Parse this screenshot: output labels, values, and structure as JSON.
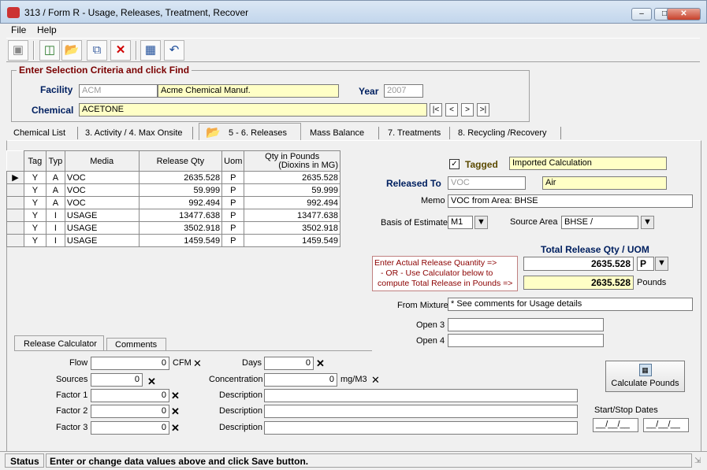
{
  "window": {
    "title": "313 / Form R - Usage, Releases, Treatment, Recover",
    "min": "–",
    "max": "□",
    "close": "✕"
  },
  "menu": {
    "file": "File",
    "help": "Help"
  },
  "toolbar": {
    "icons": [
      "binoculars-icon",
      "database-icon",
      "open-folder-icon",
      "copy-icon",
      "delete-x-icon",
      "save-disk-icon",
      "undo-icon"
    ]
  },
  "criteria": {
    "legend": "Enter Selection Criteria and click Find",
    "facility_label": "Facility",
    "facility_code": "ACM",
    "facility_name": "Acme Chemical Manuf.",
    "year_label": "Year",
    "year_value": "2007",
    "chemical_label": "Chemical",
    "chemical_value": "ACETONE",
    "nav": [
      "|<",
      "<",
      ">",
      ">|"
    ]
  },
  "tabs": [
    {
      "label": "Chemical List"
    },
    {
      "label": "3. Activity / 4. Max Onsite"
    },
    {
      "label": "5 - 6. Releases",
      "active": true
    },
    {
      "label": "Mass Balance"
    },
    {
      "label": "7. Treatments"
    },
    {
      "label": "8. Recycling /Recovery"
    }
  ],
  "grid": {
    "headers": [
      "Tag",
      "Typ",
      "Media",
      "Release Qty",
      "Uom",
      "Qty in Pounds",
      "(Dioxins in MG)"
    ],
    "rows": [
      {
        "tag": "Y",
        "typ": "A",
        "media": "VOC",
        "qty": "2635.528",
        "uom": "P",
        "lbs": "2635.528",
        "current": true
      },
      {
        "tag": "Y",
        "typ": "A",
        "media": "VOC",
        "qty": "59.999",
        "uom": "P",
        "lbs": "59.999"
      },
      {
        "tag": "Y",
        "typ": "A",
        "media": "VOC",
        "qty": "992.494",
        "uom": "P",
        "lbs": "992.494"
      },
      {
        "tag": "Y",
        "typ": "I",
        "media": "USAGE",
        "qty": "13477.638",
        "uom": "P",
        "lbs": "13477.638"
      },
      {
        "tag": "Y",
        "typ": "I",
        "media": "USAGE",
        "qty": "3502.918",
        "uom": "P",
        "lbs": "3502.918"
      },
      {
        "tag": "Y",
        "typ": "I",
        "media": "USAGE",
        "qty": "1459.549",
        "uom": "P",
        "lbs": "1459.549"
      }
    ]
  },
  "detail": {
    "tagged_checked": true,
    "tagged_label": "Tagged",
    "tagged_value": "Imported Calculation",
    "released_to_label": "Released To",
    "released_to_code": "VOC",
    "released_to_name": "Air",
    "memo_label": "Memo",
    "memo_value": "VOC from Area: BHSE",
    "basis_label": "Basis of Estimate",
    "basis_value": "M1",
    "source_area_label": "Source Area",
    "source_area_value": "BHSE  /",
    "total_header": "Total Release Qty  /  UOM",
    "instructions": [
      "Enter Actual Release Quantity      =>",
      "- OR -   Use Calculator below to",
      "compute Total Release in Pounds =>"
    ],
    "release_qty": "2635.528",
    "uom_value": "P",
    "pounds_value": "2635.528",
    "pounds_label": "Pounds",
    "from_mixture_label": "From Mixture",
    "from_mixture_value": "* See comments for Usage details",
    "open3_label": "Open 3",
    "open3_value": "",
    "open4_label": "Open 4",
    "open4_value": ""
  },
  "calc_tabs": {
    "release_calculator": "Release Calculator",
    "comments": "Comments"
  },
  "calc": {
    "flow_label": "Flow",
    "flow_value": "0",
    "flow_unit": "CFM",
    "days_label": "Days",
    "days_value": "0",
    "sources_label": "Sources",
    "sources_value": "0",
    "concentration_label": "Concentration",
    "concentration_value": "0",
    "concentration_unit": "mg/M3",
    "factor1_label": "Factor 1",
    "factor1_value": "0",
    "factor2_label": "Factor 2",
    "factor2_value": "0",
    "factor3_label": "Factor 3",
    "factor3_value": "0",
    "description_label": "Description",
    "desc1": "",
    "desc2": "",
    "desc3": "",
    "x_glyph": "✕",
    "calculate_label": "Calculate Pounds",
    "dates_label": "Start/Stop Dates",
    "start_date": "__/__/__",
    "stop_date": "__/__/__"
  },
  "status": {
    "label": "Status",
    "message": "Enter or change data values above and click Save button."
  }
}
